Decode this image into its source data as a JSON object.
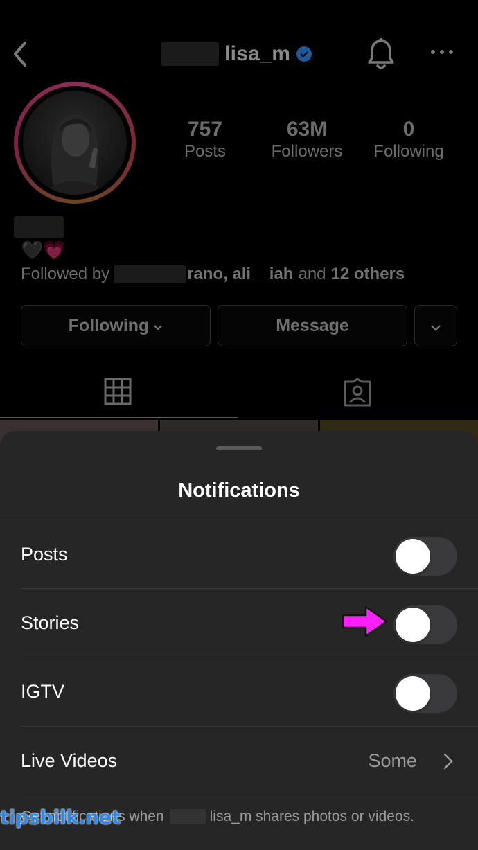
{
  "header": {
    "username": "lisa_m",
    "verified_icon": "verified-badge-icon",
    "back_icon": "chevron-left-icon",
    "bell_icon": "bell-icon",
    "more_icon": "more-horizontal-icon"
  },
  "profile": {
    "stats": [
      {
        "value": "757",
        "label": "Posts"
      },
      {
        "value": "63M",
        "label": "Followers"
      },
      {
        "value": "0",
        "label": "Following"
      }
    ],
    "bio_emoji": "🖤💗",
    "followed_by_prefix": "Followed by",
    "followed_by_names": "rano, ali__iah",
    "followed_by_and": "and",
    "followed_by_others": "12 others",
    "buttons": {
      "following": "Following",
      "message": "Message"
    }
  },
  "sheet": {
    "title": "Notifications",
    "rows": [
      {
        "label": "Posts",
        "enabled": false
      },
      {
        "label": "Stories",
        "enabled": false
      },
      {
        "label": "IGTV",
        "enabled": false
      }
    ],
    "live_videos": {
      "label": "Live Videos",
      "value": "Some"
    },
    "footer_prefix": "Get notifications when",
    "footer_suffix": "lisa_m shares photos or videos."
  },
  "watermark": "tipsbilk.net",
  "colors": {
    "sheet_bg": "#262626",
    "toggle_off": "#3a3a3c",
    "annotation_arrow": "#ff1fff",
    "verified": "#3897f0"
  }
}
